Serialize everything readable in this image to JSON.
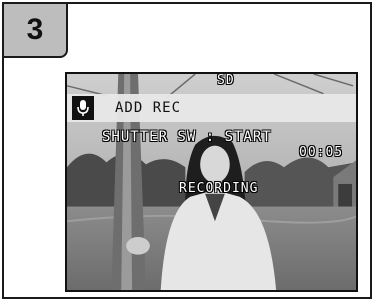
{
  "step": {
    "number": "3"
  },
  "screen": {
    "card_indicator": "SD",
    "mode": {
      "icon": "microphone-icon",
      "label": "ADD REC"
    },
    "hint": "SHUTTER SW : START",
    "elapsed_time": "00:05",
    "status": "RECORDING"
  },
  "colors": {
    "badge_bg": "#bdbdbd",
    "mode_bar_bg": "#e8e8e8",
    "osd_text": "#ffffff"
  }
}
